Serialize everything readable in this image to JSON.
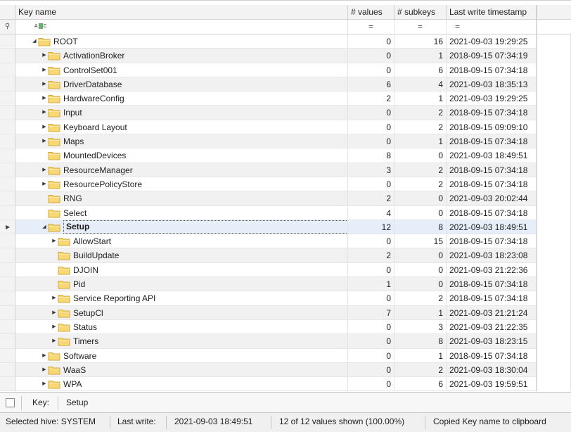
{
  "columns": {
    "key_name": "Key name",
    "values": "# values",
    "subkeys": "# subkeys",
    "timestamp": "Last write timestamp"
  },
  "filter": {
    "pin_icon": "pin-icon",
    "text_filter_icon": "abc-filter-icon",
    "text_filter_label": "ABC",
    "equals_symbol": "="
  },
  "rows": [
    {
      "name": "ROOT",
      "level": 0,
      "expander": "expanded",
      "values": "0",
      "subkeys": "16",
      "timestamp": "2021-09-03 19:29:25"
    },
    {
      "name": "ActivationBroker",
      "level": 1,
      "expander": "collapsed",
      "values": "0",
      "subkeys": "1",
      "timestamp": "2018-09-15 07:34:19"
    },
    {
      "name": "ControlSet001",
      "level": 1,
      "expander": "collapsed",
      "values": "0",
      "subkeys": "6",
      "timestamp": "2018-09-15 07:34:18"
    },
    {
      "name": "DriverDatabase",
      "level": 1,
      "expander": "collapsed",
      "values": "6",
      "subkeys": "4",
      "timestamp": "2021-09-03 18:35:13"
    },
    {
      "name": "HardwareConfig",
      "level": 1,
      "expander": "collapsed",
      "values": "2",
      "subkeys": "1",
      "timestamp": "2021-09-03 19:29:25"
    },
    {
      "name": "Input",
      "level": 1,
      "expander": "collapsed",
      "values": "0",
      "subkeys": "2",
      "timestamp": "2018-09-15 07:34:18"
    },
    {
      "name": "Keyboard Layout",
      "level": 1,
      "expander": "collapsed",
      "values": "0",
      "subkeys": "2",
      "timestamp": "2018-09-15 09:09:10"
    },
    {
      "name": "Maps",
      "level": 1,
      "expander": "collapsed",
      "values": "0",
      "subkeys": "1",
      "timestamp": "2018-09-15 07:34:18"
    },
    {
      "name": "MountedDevices",
      "level": 1,
      "expander": "none",
      "values": "8",
      "subkeys": "0",
      "timestamp": "2021-09-03 18:49:51"
    },
    {
      "name": "ResourceManager",
      "level": 1,
      "expander": "collapsed",
      "values": "3",
      "subkeys": "2",
      "timestamp": "2018-09-15 07:34:18"
    },
    {
      "name": "ResourcePolicyStore",
      "level": 1,
      "expander": "collapsed",
      "values": "0",
      "subkeys": "2",
      "timestamp": "2018-09-15 07:34:18"
    },
    {
      "name": "RNG",
      "level": 1,
      "expander": "none",
      "values": "2",
      "subkeys": "0",
      "timestamp": "2021-09-03 20:02:44"
    },
    {
      "name": "Select",
      "level": 1,
      "expander": "none",
      "values": "4",
      "subkeys": "0",
      "timestamp": "2018-09-15 07:34:18"
    },
    {
      "name": "Setup",
      "level": 1,
      "expander": "expanded",
      "values": "12",
      "subkeys": "8",
      "timestamp": "2021-09-03 18:49:51",
      "selected": true
    },
    {
      "name": "AllowStart",
      "level": 2,
      "expander": "collapsed",
      "values": "0",
      "subkeys": "15",
      "timestamp": "2018-09-15 07:34:18"
    },
    {
      "name": "BuildUpdate",
      "level": 2,
      "expander": "none",
      "values": "2",
      "subkeys": "0",
      "timestamp": "2021-09-03 18:23:08"
    },
    {
      "name": "DJOIN",
      "level": 2,
      "expander": "none",
      "values": "0",
      "subkeys": "0",
      "timestamp": "2021-09-03 21:22:36"
    },
    {
      "name": "Pid",
      "level": 2,
      "expander": "none",
      "values": "1",
      "subkeys": "0",
      "timestamp": "2018-09-15 07:34:18"
    },
    {
      "name": "Service Reporting API",
      "level": 2,
      "expander": "collapsed",
      "values": "0",
      "subkeys": "2",
      "timestamp": "2018-09-15 07:34:18"
    },
    {
      "name": "SetupCl",
      "level": 2,
      "expander": "collapsed",
      "values": "7",
      "subkeys": "1",
      "timestamp": "2021-09-03 21:21:24"
    },
    {
      "name": "Status",
      "level": 2,
      "expander": "collapsed",
      "values": "0",
      "subkeys": "3",
      "timestamp": "2021-09-03 21:22:35"
    },
    {
      "name": "Timers",
      "level": 2,
      "expander": "collapsed",
      "values": "0",
      "subkeys": "8",
      "timestamp": "2021-09-03 18:23:15"
    },
    {
      "name": "Software",
      "level": 1,
      "expander": "collapsed",
      "values": "0",
      "subkeys": "1",
      "timestamp": "2018-09-15 07:34:18"
    },
    {
      "name": "WaaS",
      "level": 1,
      "expander": "collapsed",
      "values": "0",
      "subkeys": "2",
      "timestamp": "2021-09-03 18:30:04"
    },
    {
      "name": "WPA",
      "level": 1,
      "expander": "collapsed",
      "values": "0",
      "subkeys": "6",
      "timestamp": "2021-09-03 19:59:51"
    }
  ],
  "keybar": {
    "key_label": "Key:",
    "key_value": "Setup"
  },
  "status": {
    "hive": "Selected hive: SYSTEM",
    "last_write_label": "Last write:",
    "last_write_value": "2021-09-03 18:49:51",
    "shown": "12 of 12 values shown (100.00%)",
    "message": "Copied Key name to clipboard"
  },
  "colors": {
    "folder_fill": "#f8d775",
    "folder_stroke": "#d3a73a",
    "selected_row": "#e5eef9",
    "alt_row": "#f1f1f1"
  }
}
